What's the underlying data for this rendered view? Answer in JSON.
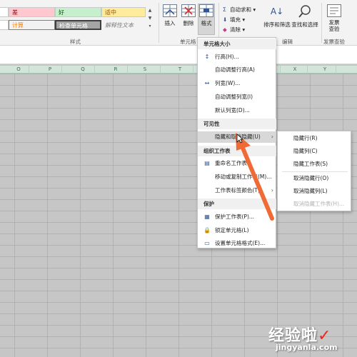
{
  "ribbon": {
    "styles": {
      "bad": "差",
      "good": "好",
      "neutral": "适中",
      "calculation": "计算",
      "check_cell": "检查单元格",
      "explanatory": "解释性文本",
      "group_label": "样式"
    },
    "cells_group": {
      "insert": "插入",
      "delete": "删除",
      "format": "格式",
      "group_label": "单元格"
    },
    "editing_group": {
      "autosum": "自动求和",
      "fill": "填充",
      "clear": "清除",
      "sort_filter": "排序和筛选",
      "find_select": "查找和选择",
      "group_label": "编辑"
    },
    "invoice_group": {
      "invoice_check": "发票\n查验",
      "group_label": "发票查验"
    }
  },
  "column_headers": [
    "O",
    "P",
    "Q",
    "R",
    "S",
    "T",
    "U",
    "V",
    "W",
    "X",
    "Y"
  ],
  "format_menu": {
    "cell_size_header": "单元格大小",
    "row_height": "行高(H)...",
    "autofit_row": "自动调整行高(A)",
    "col_width": "列宽(W)...",
    "autofit_col": "自动调整列宽(I)",
    "default_width": "默认列宽(D)...",
    "visibility_header": "可见性",
    "hide_unhide": "隐藏和取消隐藏(U)",
    "organize_header": "组织工作表",
    "rename_sheet": "重命名工作表",
    "move_copy": "移动或复制工作表(M)...",
    "tab_color": "工作表标签颜色(T)",
    "protection_header": "保护",
    "protect_sheet": "保护工作表(P)...",
    "lock_cell": "锁定单元格(L)",
    "format_cells": "设置单元格格式(E)..."
  },
  "hide_submenu": {
    "hide_rows": "隐藏行(R)",
    "hide_cols": "隐藏列(C)",
    "hide_sheet": "隐藏工作表(S)",
    "unhide_rows": "取消隐藏行(O)",
    "unhide_cols": "取消隐藏列(L)",
    "unhide_sheet": "取消隐藏工作表(H)..."
  },
  "watermark": {
    "brand": "经验啦",
    "check": "✓",
    "url": "jingyanla.com"
  },
  "colors": {
    "bad_bg": "#ffc7ce",
    "bad_text": "#9c0006",
    "good_bg": "#c6efce",
    "good_text": "#006100",
    "neutral_bg": "#ffeb9c",
    "neutral_text": "#9c5700",
    "calc_bg": "#f2f2f2",
    "calc_text": "#fa7d00",
    "check_bg": "#a5a5a5",
    "arrow": "#f06a36",
    "column_header_bg": "#d3e5db"
  }
}
